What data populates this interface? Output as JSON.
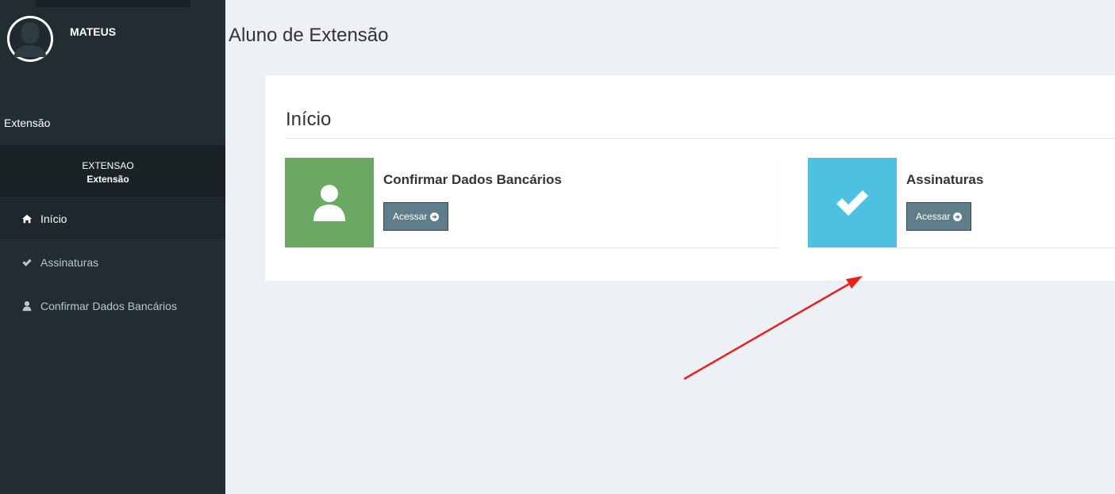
{
  "sidebar": {
    "user_name": "MATEUS",
    "section_title": "Extensão",
    "unit": {
      "line1": "EXTENSAO",
      "line2": "Extensão"
    },
    "items": [
      {
        "label": "Início",
        "icon": "home-icon",
        "active": true
      },
      {
        "label": "Assinaturas",
        "icon": "check-icon",
        "active": false
      },
      {
        "label": "Confirmar Dados Bancários",
        "icon": "user-icon",
        "active": false
      }
    ]
  },
  "header": {
    "title": "Aluno de Extensão"
  },
  "panel": {
    "title": "Início",
    "boxes": [
      {
        "title": "Confirmar Dados Bancários",
        "button": "Acessar",
        "icon": "user-icon",
        "color": "#6aa863"
      },
      {
        "title": "Assinaturas",
        "button": "Acessar",
        "icon": "check-icon",
        "color": "#4fc1e0"
      }
    ]
  },
  "colors": {
    "sidebar_bg": "#222d32",
    "content_bg": "#edf0f4",
    "button_bg": "#607d8b",
    "annotation": "#e8201e"
  }
}
